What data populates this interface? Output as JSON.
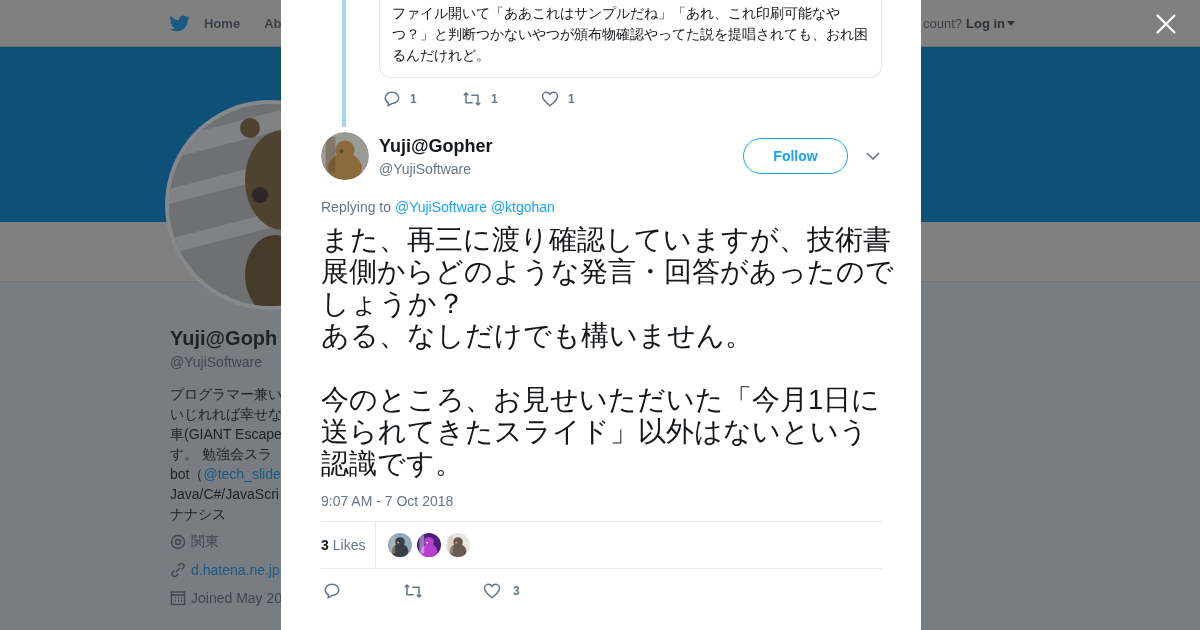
{
  "background_page": {
    "nav": {
      "items": [
        {
          "label": "Home",
          "selected": false
        },
        {
          "label": "Ab",
          "selected": false
        }
      ],
      "account_prompt": "count?",
      "login": "Log in"
    },
    "profile": {
      "name": "Yuji@Goph",
      "handle": "@YujiSoftware",
      "bio": [
        {
          "text": "プログラマー兼い"
        },
        {
          "text": "いじれれば幸せな"
        },
        {
          "text": "車(GIANT Escape"
        },
        {
          "text": "す。 勉強会スラ"
        },
        {
          "text": "bot（",
          "link": "@tech_slide"
        },
        {
          "text": "Java/C#/JavaScri"
        },
        {
          "text": "ナナシス"
        }
      ],
      "location": "関東",
      "website": "d.hatena.ne.jp",
      "joined": "Joined May 20"
    }
  },
  "modal": {
    "quoted_reply": {
      "lines": [
        "ファイル開いて「ああこれはサンプルだね」「あれ、これ印刷可能なや",
        "つ？」と判断つかないやつが頒布物確認やってた説を提唱されても、おれ困",
        "るんだけれど。"
      ],
      "replies": "1",
      "retweets": "1",
      "likes": "1"
    },
    "tweet": {
      "author": "Yuji@Gopher",
      "handle": "@YujiSoftware",
      "follow_button": "Follow",
      "replying_label": "Replying to",
      "replying_to": [
        "@YujiSoftware",
        "@ktgohan"
      ],
      "paragraphs": [
        [
          "また、再三に渡り確認していますが、技術書",
          "展側からどのような発言・回答があったので",
          "しょうか？",
          "ある、なしだけでも構いません。"
        ],
        [
          "今のところ、お見せいただいた「今月1日に",
          "送られてきたスライド」以外はないという",
          "認識です。"
        ]
      ],
      "time": "9:07 AM - 7 Oct 2018",
      "like_count": "3",
      "likes_label": "Likes",
      "likers": [
        {
          "kind": "picture"
        },
        {
          "kind": "picture"
        },
        {
          "kind": "picture"
        }
      ],
      "actions": {
        "likes": "3"
      }
    }
  }
}
